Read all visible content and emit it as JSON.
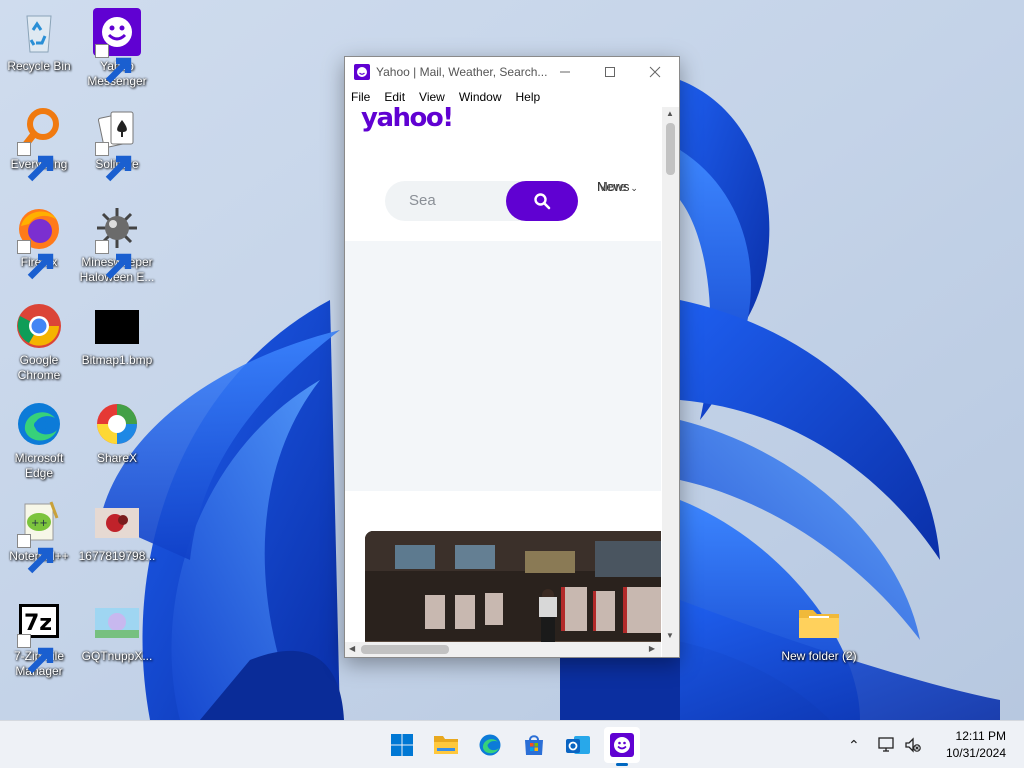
{
  "desktop": {
    "icons": [
      {
        "label": "Recycle Bin"
      },
      {
        "label": "Yahoo Messenger"
      },
      {
        "label": "Everything"
      },
      {
        "label": "Solitaire"
      },
      {
        "label": "Firefox"
      },
      {
        "label": "Minesweeper Haloween E..."
      },
      {
        "label": "Google Chrome"
      },
      {
        "label": "Bitmap1.bmp"
      },
      {
        "label": "Microsoft Edge"
      },
      {
        "label": "ShareX"
      },
      {
        "label": "Notepad++"
      },
      {
        "label": "1677819798..."
      },
      {
        "label": "7-Zip File Manager"
      },
      {
        "label": "GQTnuppX..."
      },
      {
        "label": "New folder (2)"
      }
    ]
  },
  "window": {
    "title": "Yahoo | Mail, Weather, Search...",
    "menu": [
      "File",
      "Edit",
      "View",
      "Window",
      "Help"
    ],
    "page": {
      "logo": "yahoo!",
      "search_placeholder": "Sea",
      "nav_text": "News",
      "nav_more": "More"
    }
  },
  "taskbar": {
    "apps": [
      "start",
      "file-explorer",
      "edge",
      "store",
      "outlook",
      "yahoo-messenger"
    ],
    "time": "12:11 PM",
    "date": "10/31/2024"
  },
  "colors": {
    "yahoo_purple": "#6001d2",
    "taskbar_bg": "#eef1f6",
    "accent": "#0067c0"
  }
}
